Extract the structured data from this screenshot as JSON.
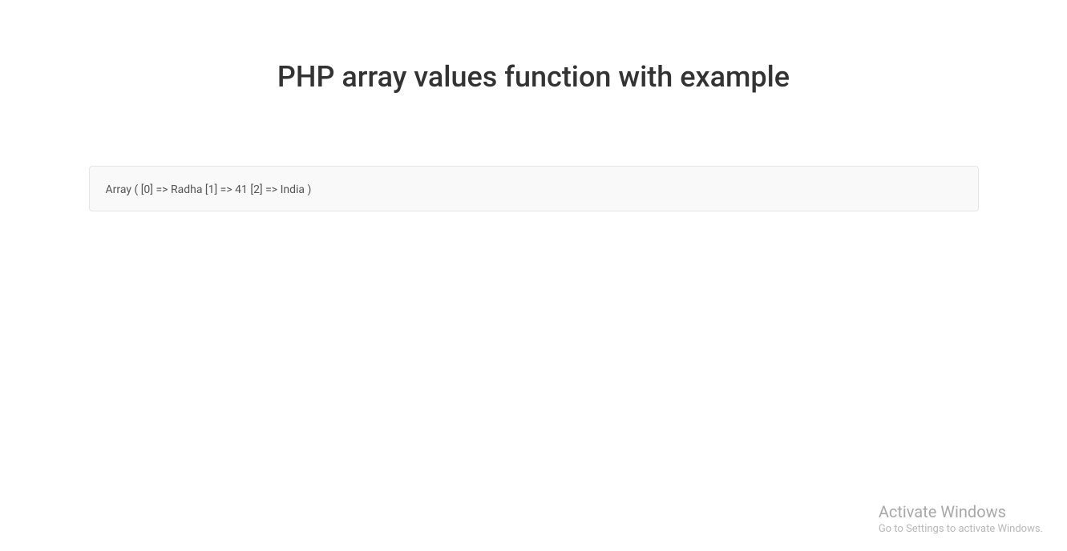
{
  "header": {
    "title": "PHP array values function with example"
  },
  "output": {
    "text": "Array ( [0] => Radha [1] => 41 [2] => India )"
  },
  "watermark": {
    "title": "Activate Windows",
    "subtitle": "Go to Settings to activate Windows."
  }
}
